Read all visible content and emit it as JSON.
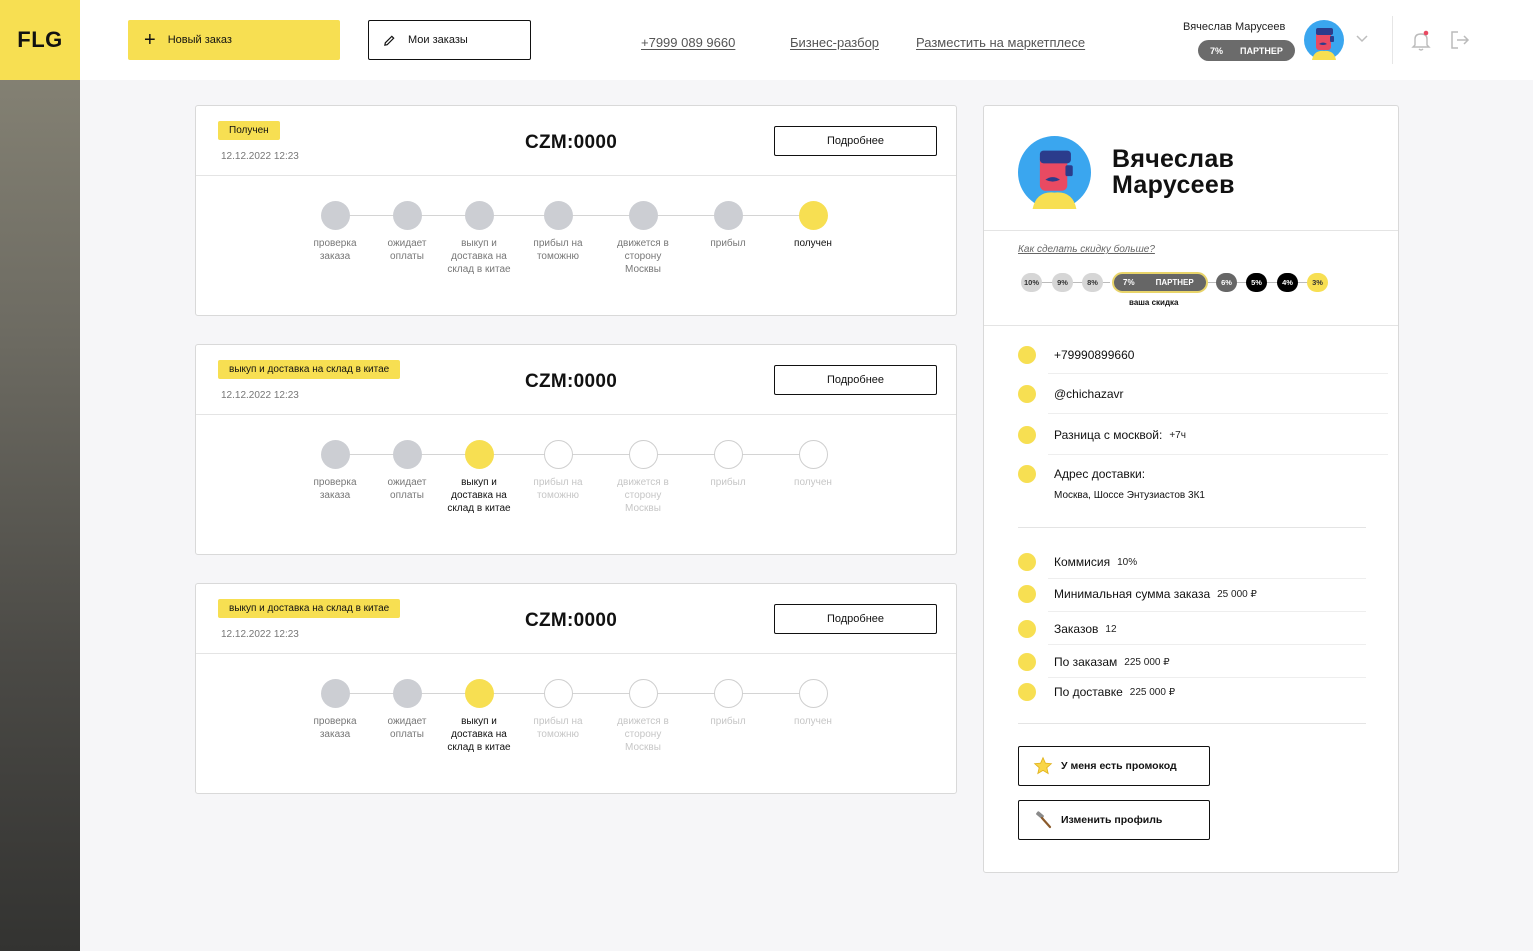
{
  "brand": {
    "logo": "FLG"
  },
  "header": {
    "new_order": "Новый заказ",
    "my_orders": "Мои заказы",
    "phone": "+7999 089 9660",
    "business": "Бизнес-разбор",
    "marketplace": "Разместить на маркетплесе",
    "user_name": "Вячеслав Марусеев",
    "badge_pct": "7%",
    "badge_label": "ПАРТНЕР"
  },
  "orders": [
    {
      "status": "Получен",
      "date": "12.12.2022 12:23",
      "number": "CZM:0000",
      "more": "Подробнее",
      "steps": [
        {
          "label": "проверка заказа",
          "state": "done"
        },
        {
          "label": "ожидает оплаты",
          "state": "done"
        },
        {
          "label": "выкуп и доставка на склад в китае",
          "state": "done"
        },
        {
          "label": "прибыл на томожню",
          "state": "done"
        },
        {
          "label": "движется в сторону Москвы",
          "state": "done"
        },
        {
          "label": "прибыл",
          "state": "done"
        },
        {
          "label": "получен",
          "state": "current"
        }
      ]
    },
    {
      "status": "выкуп и доставка на склад в китае",
      "date": "12.12.2022 12:23",
      "number": "CZM:0000",
      "more": "Подробнее",
      "steps": [
        {
          "label": "проверка заказа",
          "state": "done"
        },
        {
          "label": "ожидает оплаты",
          "state": "done"
        },
        {
          "label": "выкуп и доставка на склад в китае",
          "state": "current"
        },
        {
          "label": "прибыл на томожню",
          "state": "pending"
        },
        {
          "label": "движется в сторону Москвы",
          "state": "pending"
        },
        {
          "label": "прибыл",
          "state": "pending"
        },
        {
          "label": "получен",
          "state": "pending"
        }
      ]
    },
    {
      "status": "выкуп и доставка на склад в китае",
      "date": "12.12.2022 12:23",
      "number": "CZM:0000",
      "more": "Подробнее",
      "steps": [
        {
          "label": "проверка заказа",
          "state": "done"
        },
        {
          "label": "ожидает оплаты",
          "state": "done"
        },
        {
          "label": "выкуп и доставка на склад в китае",
          "state": "current"
        },
        {
          "label": "прибыл на томожню",
          "state": "pending"
        },
        {
          "label": "движется в сторону Москвы",
          "state": "pending"
        },
        {
          "label": "прибыл",
          "state": "pending"
        },
        {
          "label": "получен",
          "state": "pending"
        }
      ]
    }
  ],
  "profile": {
    "name_line1": "Вячеслав",
    "name_line2": "Марусеев",
    "how_discount": "Как сделать скидку больше?",
    "discount_levels": [
      "10%",
      "9%",
      "8%",
      "6%",
      "5%",
      "4%",
      "3%"
    ],
    "current_pct": "7%",
    "current_label": "ПАРТНЕР",
    "your_discount": "ваша скидка",
    "phone": "+79990899660",
    "nick": "@chichazavr",
    "tz_label": "Разница с москвой:",
    "tz_value": "+7ч",
    "address_label": "Адрес доставки:",
    "address_value": "Москва, Шоссе Энтузиастов 3К1",
    "commission_label": "Коммисия",
    "commission_value": "10%",
    "min_sum_label": "Минимальная сумма заказа",
    "min_sum_value": "25 000 ₽",
    "orders_label": "Заказов",
    "orders_value": "12",
    "by_orders_label": "По заказам",
    "by_orders_value": "225 000 ₽",
    "by_delivery_label": "По доставке",
    "by_delivery_value": "225 000 ₽",
    "promo_button": "У меня есть промокод",
    "edit_button": "Изменить профиль"
  },
  "icons": {
    "plus": "plus-icon",
    "pencil": "pencil-icon",
    "bell": "bell-icon",
    "logout": "logout-icon",
    "star": "star-icon",
    "hammer": "hammer-icon"
  },
  "colors": {
    "accent": "#f7df52",
    "done_dot": "#ccced3",
    "dark_badge": "#6b6b6b"
  }
}
